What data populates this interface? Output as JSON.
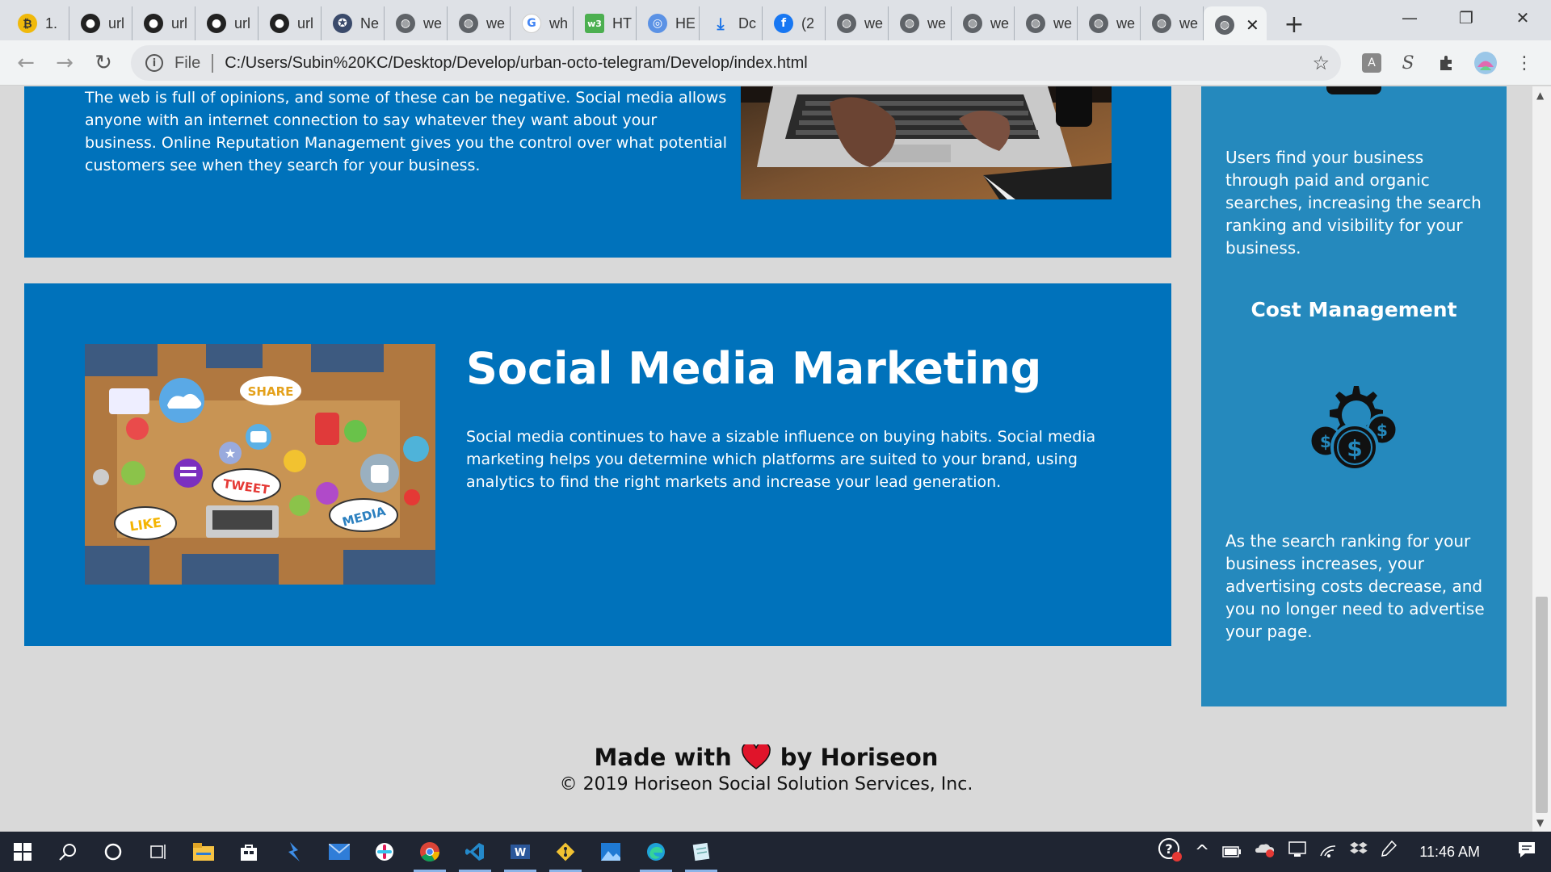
{
  "browser": {
    "tabs": [
      {
        "favicon": "bitcoin-icon",
        "title": "1."
      },
      {
        "favicon": "github-icon",
        "title": "url"
      },
      {
        "favicon": "github-icon",
        "title": "url"
      },
      {
        "favicon": "github-icon",
        "title": "url"
      },
      {
        "favicon": "github-icon",
        "title": "url"
      },
      {
        "favicon": "seal-icon",
        "title": "Ne"
      },
      {
        "favicon": "globe-icon",
        "title": "we"
      },
      {
        "favicon": "globe-icon",
        "title": "we"
      },
      {
        "favicon": "google-icon",
        "title": "wh"
      },
      {
        "favicon": "w3-icon",
        "title": "HT"
      },
      {
        "favicon": "un-icon",
        "title": "HE"
      },
      {
        "favicon": "download-icon",
        "title": "Dc"
      },
      {
        "favicon": "facebook-icon",
        "title": "(2"
      },
      {
        "favicon": "globe-icon",
        "title": "we"
      },
      {
        "favicon": "globe-icon",
        "title": "we"
      },
      {
        "favicon": "globe-icon",
        "title": "we"
      },
      {
        "favicon": "globe-icon",
        "title": "we"
      },
      {
        "favicon": "globe-icon",
        "title": "we"
      },
      {
        "favicon": "globe-icon",
        "title": "we"
      }
    ],
    "active_tab_favicon": "globe-icon",
    "close_glyph": "✕",
    "new_tab_glyph": "+",
    "window_controls": {
      "minimize": "—",
      "restore": "❐",
      "close": "✕"
    },
    "nav": {
      "back": "←",
      "forward": "→",
      "reload": "↻"
    },
    "omnibox": {
      "scheme_label": "File",
      "url": "C:/Users/Subin%20KC/Desktop/Develop/urban-octo-telegram/Develop/index.html",
      "bookmark_glyph": "☆"
    }
  },
  "page": {
    "reputation": {
      "text": "The web is full of opinions, and some of these can be negative. Social media allows anyone with an internet connection to say whatever they want about your business. Online Reputation Management gives you the control over what potential customers see when they search for your business."
    },
    "social": {
      "heading": "Social Media Marketing",
      "text": "Social media continues to have a sizable influence on buying habits. Social media marketing helps you determine which platforms are suited to your brand, using analytics to find the right markets and increase your lead generation.",
      "image_words": [
        "SHARE",
        "TWEET",
        "LIKE",
        "MEDIA"
      ]
    },
    "sidebar": {
      "lead_text": "Users find your business through paid and organic searches, increasing the search ranking and visibility for your business.",
      "cost_heading": "Cost Management",
      "cost_text": "As the search ranking for your business increases, your advertising costs decrease, and you no longer need to advertise your page."
    },
    "footer": {
      "made_with": "Made with",
      "by": "by Horiseon",
      "copyright": "© 2019 Horiseon Social Solution Services, Inc."
    }
  },
  "taskbar": {
    "clock": "11:46 AM",
    "apps": [
      "windows-start-icon",
      "search-icon",
      "cortana-icon",
      "task-view-icon",
      "file-explorer-icon",
      "store-icon",
      "power-automate-icon",
      "mail-icon",
      "slack-icon",
      "chrome-icon",
      "vscode-icon",
      "word-icon",
      "git-icon",
      "photos-icon",
      "edge-icon",
      "notepad-icon"
    ]
  },
  "colors": {
    "card": "#0072bb",
    "sidebar": "#2589bd",
    "page_bg": "#d9d9d9",
    "heart": "#e0142a"
  }
}
